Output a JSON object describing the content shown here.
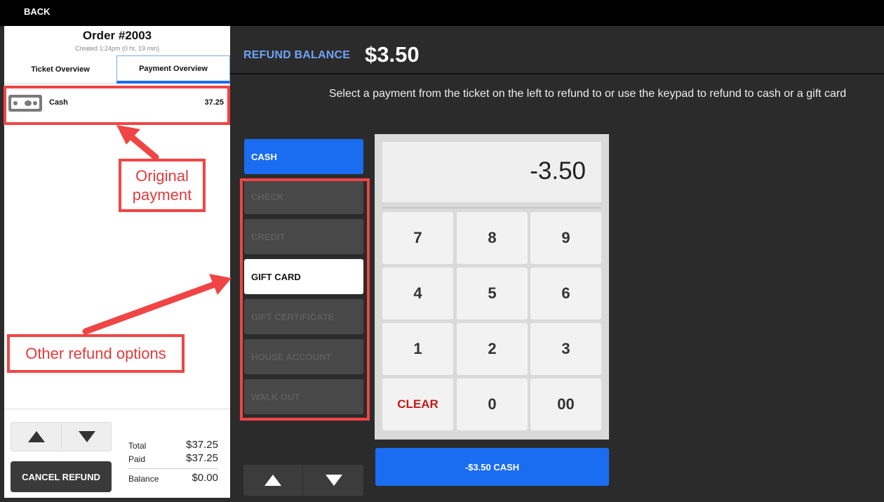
{
  "topbar": {
    "back_label": "BACK"
  },
  "order": {
    "title": "Order #2003",
    "created": "Created 1:24pm (0 hr, 19 min)"
  },
  "tabs": {
    "ticket": "Ticket Overview",
    "payment": "Payment Overview"
  },
  "payments": [
    {
      "icon": "cash-icon",
      "label": "Cash",
      "amount": "37.25"
    }
  ],
  "footer": {
    "cancel_label": "CANCEL REFUND",
    "total_label": "Total",
    "total_value": "$37.25",
    "paid_label": "Paid",
    "paid_value": "$37.25",
    "balance_label": "Balance",
    "balance_value": "$0.00"
  },
  "refund": {
    "balance_label": "REFUND BALANCE",
    "balance_value": "$3.50",
    "instructions": "Select a payment from the ticket on the left to refund to or use the keypad to refund to cash or a gift card"
  },
  "methods": [
    {
      "label": "CASH",
      "state": "active"
    },
    {
      "label": "CHECK",
      "state": "disabled"
    },
    {
      "label": "CREDIT",
      "state": "disabled"
    },
    {
      "label": "GIFT CARD",
      "state": "enabled"
    },
    {
      "label": "GIFT CERTIFICATE",
      "state": "disabled"
    },
    {
      "label": "HOUSE ACCOUNT",
      "state": "disabled"
    },
    {
      "label": "WALK OUT",
      "state": "disabled"
    }
  ],
  "keypad": {
    "display": "-3.50",
    "keys": [
      "7",
      "8",
      "9",
      "4",
      "5",
      "6",
      "1",
      "2",
      "3",
      "CLEAR",
      "0",
      "00"
    ]
  },
  "pay_button": "-$3.50 CASH",
  "annotations": {
    "original": "Original payment",
    "other": "Other refund options"
  },
  "colors": {
    "accent_blue": "#1a6cf0",
    "annotation_red": "#f04545",
    "refund_label_blue": "#6fa4f5",
    "clear_red": "#c41a1a"
  }
}
